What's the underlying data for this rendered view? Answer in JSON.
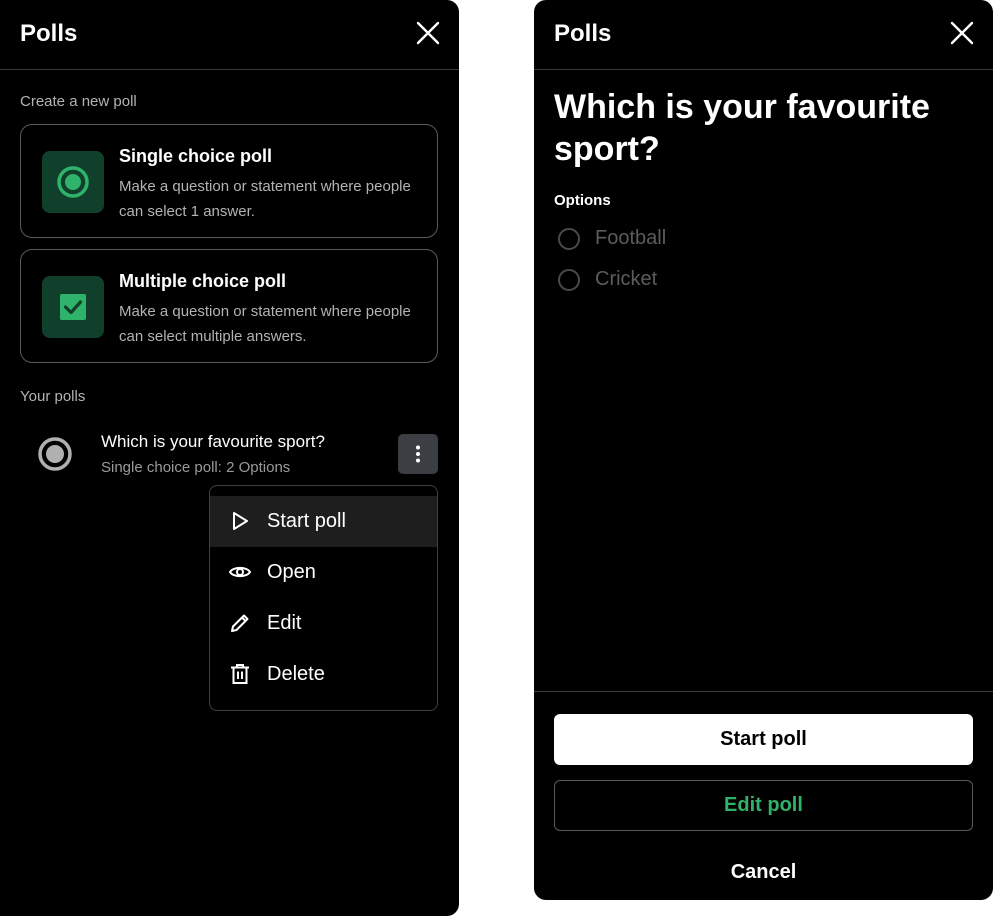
{
  "left_panel": {
    "header": {
      "title": "Polls",
      "close_icon": "close-icon"
    },
    "create_label": "Create a new poll",
    "poll_types": [
      {
        "title": "Single choice poll",
        "description": "Make a question or statement where people can select 1 answer.",
        "icon": "radio-selected-icon"
      },
      {
        "title": "Multiple choice poll",
        "description": "Make a question or statement where people can select multiple answers.",
        "icon": "checkbox-checked-icon"
      }
    ],
    "your_polls_label": "Your polls",
    "poll": {
      "title": "Which is your favourite sport?",
      "subtitle": "Single choice poll: 2 Options",
      "icon": "radio-selected-icon",
      "more_icon": "more-vertical-icon"
    },
    "menu": {
      "items": [
        {
          "label": "Start poll",
          "icon": "play-icon"
        },
        {
          "label": "Open",
          "icon": "eye-icon"
        },
        {
          "label": "Edit",
          "icon": "pencil-icon"
        },
        {
          "label": "Delete",
          "icon": "trash-icon"
        }
      ]
    }
  },
  "right_panel": {
    "header": {
      "title": "Polls",
      "close_icon": "close-icon"
    },
    "question": "Which is your favourite sport?",
    "options_label": "Options",
    "options": [
      "Football",
      "Cricket"
    ],
    "buttons": {
      "start": "Start poll",
      "edit": "Edit poll",
      "cancel": "Cancel"
    }
  },
  "colors": {
    "background": "#000000",
    "accent_green": "#2fb36a",
    "icon_box_green": "#10402b",
    "muted_text": "#b3b3b3",
    "border": "#5a5a5a"
  }
}
